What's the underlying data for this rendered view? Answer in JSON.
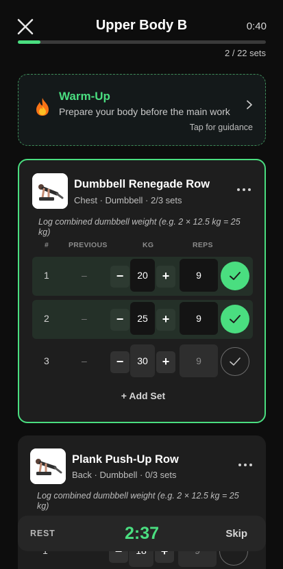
{
  "header": {
    "title": "Upper Body B",
    "elapsed": "0:40",
    "progress_fraction": 0.0909,
    "sets_count": "2 / 22 sets"
  },
  "warmup": {
    "title": "Warm-Up",
    "description": "Prepare your body before the main work",
    "hint": "Tap for guidance",
    "icon": "flame-icon"
  },
  "exercises": [
    {
      "name": "Dumbbell Renegade Row",
      "meta": "Chest · Dumbbell · 2/3 sets",
      "note": "Log combined dumbbell weight (e.g. 2 × 12.5 kg = 25 kg)",
      "columns": {
        "num": "#",
        "previous": "PREVIOUS",
        "kg": "KG",
        "reps": "REPS"
      },
      "sets": [
        {
          "num": "1",
          "previous": "–",
          "kg": "20",
          "reps": "9",
          "done": true
        },
        {
          "num": "2",
          "previous": "–",
          "kg": "25",
          "reps": "9",
          "done": true
        },
        {
          "num": "3",
          "previous": "–",
          "kg": "30",
          "reps": "9",
          "done": false
        }
      ],
      "add_set_label": "+  Add Set"
    },
    {
      "name": "Plank Push-Up Row",
      "meta": "Back · Dumbbell · 0/3 sets",
      "note": "Log combined dumbbell weight (e.g. 2 × 12.5 kg = 25 kg)",
      "sets": [
        {
          "num": "1",
          "kg": "18",
          "reps": "9"
        }
      ]
    }
  ],
  "rest": {
    "label": "REST",
    "time": "2:37",
    "skip_label": "Skip"
  },
  "colors": {
    "accent": "#4ade80",
    "background": "#0d0d0d",
    "card": "#1e1e1e"
  }
}
